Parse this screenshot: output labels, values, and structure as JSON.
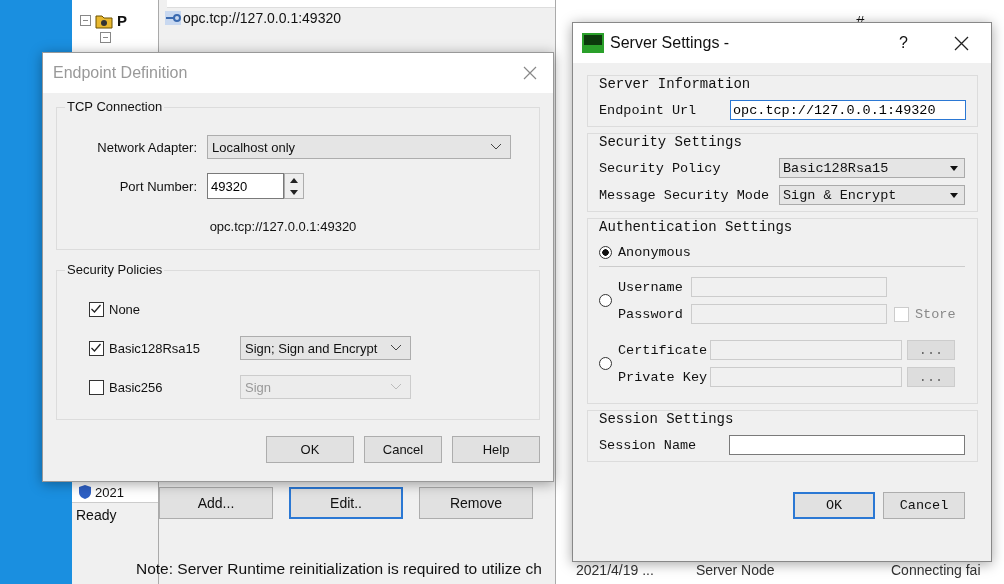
{
  "background": {
    "tree_app": {
      "tree_item": "P",
      "log_item": "2021",
      "status": "Ready"
    },
    "endpoints_window": {
      "endpoint": "opc.tcp://127.0.0.1:49320",
      "note": "Note: Server Runtime reinitialization is required to utilize ch",
      "buttons": [
        {
          "label": "Add...",
          "focused": false
        },
        {
          "label": "Edit..",
          "focused": true
        },
        {
          "label": "Remove",
          "focused": false
        }
      ]
    },
    "project_panel": {
      "column_1": "#",
      "log_row": [
        "2021/4/19 ...",
        "Server Node",
        "Connecting fai"
      ]
    }
  },
  "endpoint_dialog": {
    "title": "Endpoint Definition",
    "tcp": {
      "title": "TCP Connection",
      "adapter_label": "Network Adapter:",
      "adapter": "Localhost only",
      "port_label": "Port Number:",
      "port": "49320",
      "url": "opc.tcp://127.0.0.1:49320"
    },
    "security": {
      "title": "Security Policies",
      "policies": [
        {
          "name": "None",
          "checked": true
        },
        {
          "name": "Basic128Rsa15",
          "checked": true,
          "mode": "Sign; Sign and Encrypt",
          "mode_disabled": false
        },
        {
          "name": "Basic256",
          "checked": false,
          "mode": "Sign",
          "mode_disabled": true
        }
      ]
    },
    "buttons": [
      "OK",
      "Cancel",
      "Help"
    ]
  },
  "server_settings": {
    "title": "Server Settings -",
    "help": "?",
    "info": {
      "title": "Server Information",
      "url_label": "Endpoint Url",
      "url": "opc.tcp://127.0.0.1:49320"
    },
    "security": {
      "title": "Security Settings",
      "policy_label": "Security Policy",
      "policy": "Basic128Rsa15",
      "mode_label": "Message Security Mode",
      "mode": "Sign & Encrypt"
    },
    "auth": {
      "title": "Authentication Settings",
      "options": [
        {
          "kind": "anonymous",
          "selected": true,
          "label": "Anonymous"
        },
        {
          "kind": "user",
          "selected": false,
          "user_label": "Username",
          "password_label": "Password",
          "store_label": "Store",
          "store_checked": false
        },
        {
          "kind": "certificate",
          "selected": false,
          "cert_label": "Certificate",
          "key_label": "Private Key",
          "browse": "..."
        }
      ]
    },
    "session": {
      "title": "Session Settings",
      "name_label": "Session Name"
    },
    "buttons": [
      {
        "label": "OK",
        "focused": true
      },
      {
        "label": "Cancel",
        "focused": false
      }
    ]
  }
}
